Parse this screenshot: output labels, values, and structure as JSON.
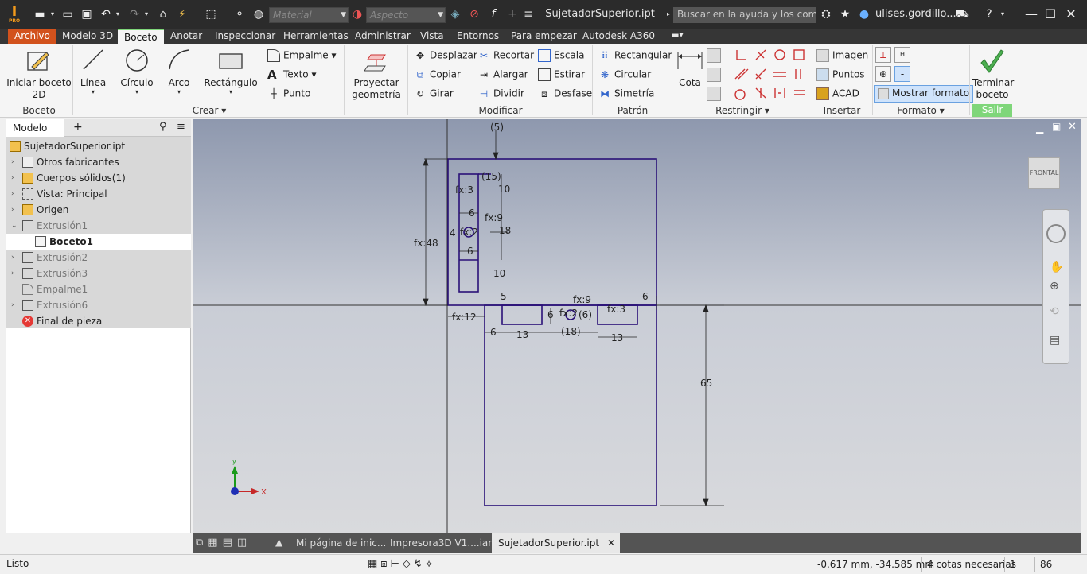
{
  "titlebar": {
    "material_placeholder": "Material",
    "appearance_placeholder": "Aspecto",
    "doc_title": "SujetadorSuperior.ipt",
    "search_placeholder": "Buscar en la ayuda y los comandos",
    "user": "ulises.gordillo...",
    "logo_text": "I",
    "logo_sub": "PRO"
  },
  "ribbon_tabs": [
    "Archivo",
    "Modelo 3D",
    "Boceto",
    "Anotar",
    "Inspeccionar",
    "Herramientas",
    "Administrar",
    "Vista",
    "Entornos",
    "Para empezar",
    "Autodesk A360"
  ],
  "ribbon": {
    "boceto": {
      "start": "Iniciar boceto 2D",
      "panel": "Boceto"
    },
    "crear": {
      "linea": "Línea",
      "circulo": "Círculo",
      "arco": "Arco",
      "rectangulo": "Rectángulo",
      "empalme": "Empalme",
      "texto": "Texto",
      "punto": "Punto",
      "panel": "Crear"
    },
    "proyectar": "Proyectar geometría",
    "modificar": {
      "desplazar": "Desplazar",
      "recortar": "Recortar",
      "escala": "Escala",
      "copiar": "Copiar",
      "alargar": "Alargar",
      "estirar": "Estirar",
      "girar": "Girar",
      "dividir": "Dividir",
      "desfase": "Desfase",
      "panel": "Modificar"
    },
    "patron": {
      "rectangular": "Rectangular",
      "circular": "Circular",
      "simetria": "Simetría",
      "panel": "Patrón"
    },
    "restringir": {
      "cota": "Cota",
      "panel": "Restringir"
    },
    "insertar": {
      "imagen": "Imagen",
      "puntos": "Puntos",
      "acad": "ACAD",
      "panel": "Insertar"
    },
    "formato": {
      "mostrar": "Mostrar formato",
      "panel": "Formato"
    },
    "salir": {
      "terminar": "Terminar boceto",
      "panel": "Salir"
    }
  },
  "browser": {
    "tab": "Modelo",
    "items": [
      {
        "label": "SujetadorSuperior.ipt",
        "icon": "part-icon"
      },
      {
        "label": "Otros fabricantes",
        "icon": "third-party-icon"
      },
      {
        "label": "Cuerpos sólidos(1)",
        "icon": "solid-bodies-icon"
      },
      {
        "label": "Vista: Principal",
        "icon": "view-icon"
      },
      {
        "label": "Origen",
        "icon": "folder-icon"
      },
      {
        "label": "Extrusión1",
        "icon": "extrusion-icon"
      },
      {
        "label": "Boceto1",
        "icon": "sketch-icon"
      },
      {
        "label": "Extrusión2",
        "icon": "extrusion-icon"
      },
      {
        "label": "Extrusión3",
        "icon": "extrusion-icon"
      },
      {
        "label": "Empalme1",
        "icon": "fillet-icon"
      },
      {
        "label": "Extrusión6",
        "icon": "extrusion-icon"
      },
      {
        "label": "Final de pieza",
        "icon": "end-of-part-icon"
      }
    ]
  },
  "sketch": {
    "dims": {
      "d5": "(5)",
      "d15": "(15)",
      "fx3": "fx:3",
      "d10a": "10",
      "d6a": "6",
      "fx9": "fx:9",
      "d18": "18",
      "fx2a": "fx:2",
      "d4": "4",
      "d6b": "6",
      "fx48": "fx:48",
      "d10b": "10",
      "d5b": "5",
      "fx12": "fx:12",
      "d6c": "6",
      "d13a": "13",
      "d6d": "6",
      "fx9b": "fx:9",
      "fx2b": "fx:2",
      "d6e": "(6)",
      "fx3b": "fx:3",
      "d6f": "6",
      "d18b": "(18)",
      "d13b": "13",
      "d65": "65"
    },
    "axis_y": "y",
    "axis_x": "X",
    "viewcube": "FRONTAL"
  },
  "doctabs": [
    "Mi página de inic...",
    "Impresora3D V1....iam",
    "SujetadorSuperior.ipt"
  ],
  "status": {
    "left": "Listo",
    "coords": "-0.617 mm, -34.585 mm",
    "dims_needed": "4 cotas necesarias",
    "n1": "1",
    "n2": "86"
  },
  "colors": {
    "sketch": "#2a1178",
    "accent_orange": "#d2521d",
    "active_green": "#7fd67a"
  }
}
